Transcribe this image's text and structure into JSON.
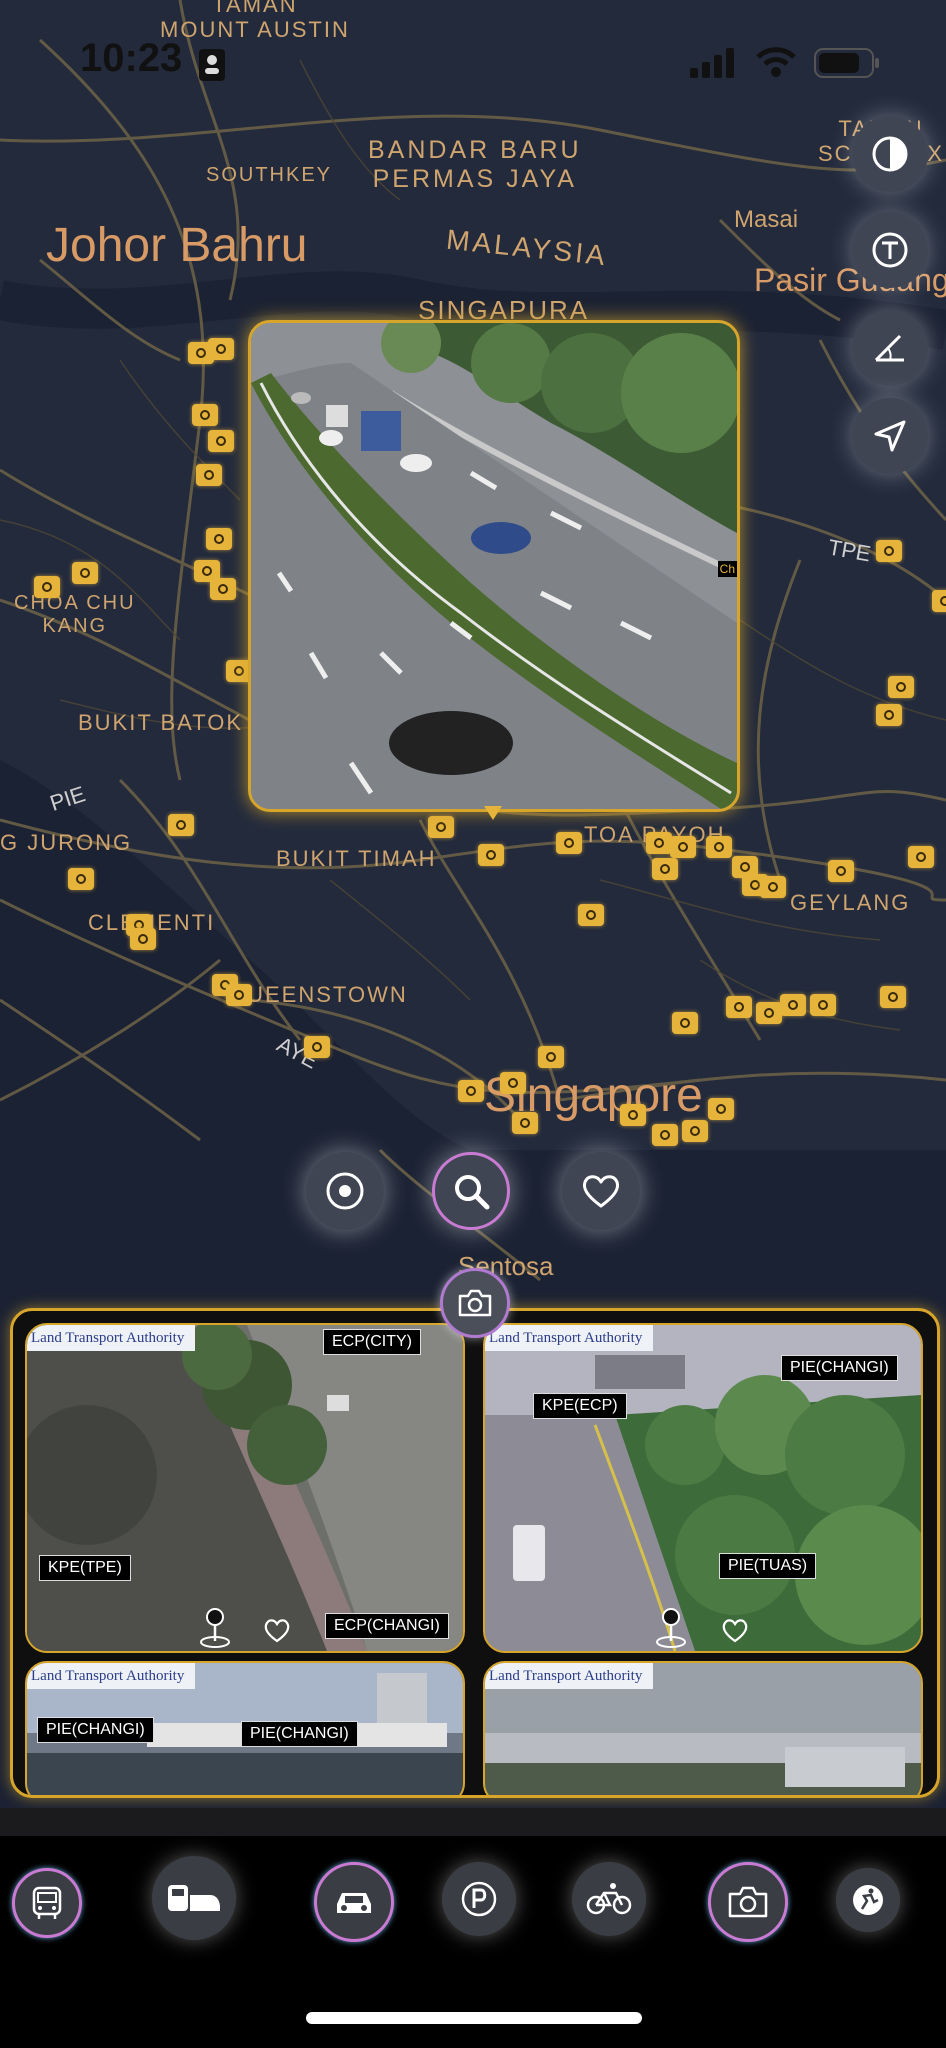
{
  "status_bar": {
    "time": "10:23"
  },
  "map": {
    "labels": {
      "taman_mount_austin": "TAMAN\nMOUNT AUSTIN",
      "southkey": "SOUTHKEY",
      "bandar_baru": "BANDAR BARU\nPERMAS JAYA",
      "johor_bahru": "Johor Bahru",
      "malaysia": "MALAYSIA",
      "masai": "Masai",
      "pasir_gudang": "Pasir Gudang",
      "taman_scientex": "TAMAN\nSCIENTEX",
      "singapura": "SINGAPURA",
      "choa_chu_kang": "CHOA CHU\nKANG",
      "bukit_batok": "BUKIT BATOK",
      "jurong": "G JURONG",
      "clementi": "CLEMENTI",
      "bukit_timah": "BUKIT TIMAH",
      "toa_payoh": "TOA PAYOH",
      "geylang": "GEYLANG",
      "queenstown": "QUEENSTOWN",
      "singapore": "Singapore",
      "sentosa": "Sentosa"
    },
    "roads": {
      "pie": "PIE",
      "tpe": "TPE",
      "aye": "AYE"
    }
  },
  "tools": [
    "contrast-icon",
    "text-icon",
    "angle-icon",
    "navigation-arrow-icon"
  ],
  "popup": {
    "edge_label": "Ch"
  },
  "actions": [
    "locate-icon",
    "search-icon",
    "heart-icon"
  ],
  "camera_panel": {
    "tiles": [
      {
        "logo": "Land Transport Authority",
        "labels": [
          "ECP(CITY)",
          "KPE(TPE)",
          "ECP(CHANGI)"
        ]
      },
      {
        "logo": "Land Transport Authority",
        "labels": [
          "KPE(ECP)",
          "PIE(CHANGI)",
          "PIE(TUAS)"
        ]
      },
      {
        "logo": "Land Transport Authority",
        "labels": [
          "PIE(CHANGI)",
          "PIE(CHANGI)"
        ]
      },
      {
        "logo": "Land Transport Authority",
        "labels": []
      }
    ]
  },
  "bottom_nav": [
    "bus-icon",
    "train-icon",
    "car-icon",
    "parking-icon",
    "bicycle-icon",
    "camera-icon",
    "activity-icon"
  ],
  "colors": {
    "accent": "#d6a52a",
    "map_bg": "#222a3c",
    "label": "#cfa46e"
  }
}
